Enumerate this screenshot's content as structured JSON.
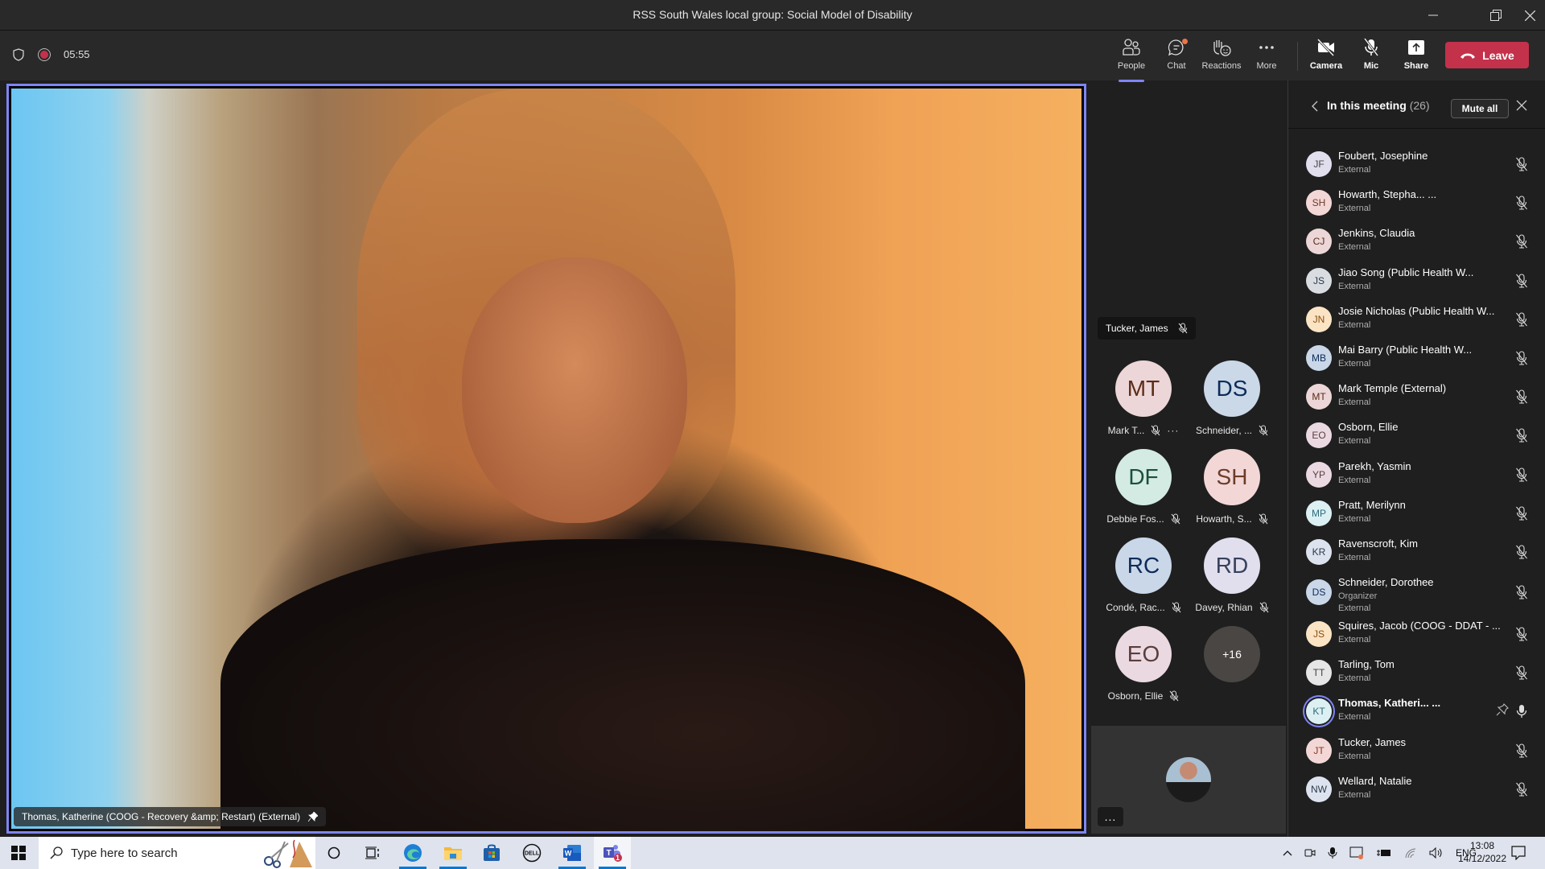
{
  "window": {
    "title": "RSS South Wales local group: Social Model of Disability",
    "controls": [
      "minimize-icon",
      "restore-icon",
      "close-icon"
    ]
  },
  "toolbar": {
    "recording": true,
    "timer": "05:55",
    "buttons": [
      {
        "label": "People",
        "icon": "people-icon",
        "active": true
      },
      {
        "label": "Chat",
        "icon": "chat-icon",
        "badge": true
      },
      {
        "label": "Reactions",
        "icon": "reactions-icon"
      },
      {
        "label": "More",
        "icon": "more-icon"
      },
      {
        "label": "Camera",
        "icon": "camera-off-icon"
      },
      {
        "label": "Mic",
        "icon": "mic-off-icon"
      },
      {
        "label": "Share",
        "icon": "share-icon"
      }
    ],
    "leave_label": "Leave",
    "colors": {
      "accent": "#7f85f5",
      "leave": "#c4314b",
      "badge": "#e97548"
    }
  },
  "stage": {
    "pinned_name": "Thomas, Katherine (COOG - Recovery &amp; Restart) (External)"
  },
  "gallery": {
    "speaking": "Tucker, James",
    "tiles": [
      {
        "initials": "MT",
        "caption": "Mark T...",
        "bg": "#ecd6d7",
        "fg": "#5b2c17",
        "more": true
      },
      {
        "initials": "DS",
        "caption": "Schneider, ...",
        "bg": "#cad8e8",
        "fg": "#0d2b59"
      },
      {
        "initials": "DF",
        "caption": "Debbie Fos...",
        "bg": "#d3ebe3",
        "fg": "#1c4f3b"
      },
      {
        "initials": "SH",
        "caption": "Howarth, S...",
        "bg": "#f3d7d7",
        "fg": "#6b3d28"
      },
      {
        "initials": "RC",
        "caption": "Condé, Rac...",
        "bg": "#c9d7e8",
        "fg": "#0d2b59"
      },
      {
        "initials": "RD",
        "caption": "Davey, Rhian",
        "bg": "#e1dfee",
        "fg": "#37405c"
      },
      {
        "initials": "EO",
        "caption": "Osborn, Ellie",
        "bg": "#ebd9e2",
        "fg": "#5a3e3c"
      },
      {
        "initials": "+16",
        "caption": "",
        "bg": "#4a4644",
        "fg": "#ffffff",
        "overflow": true
      }
    ],
    "self_more": "..."
  },
  "panel": {
    "title": "In this meeting",
    "count": "(26)",
    "mute_all": "Mute all",
    "participants": [
      {
        "initials": "JF",
        "name": "Foubert, Josephine",
        "role": "External",
        "bg": "#e1dfee",
        "fg": "#444"
      },
      {
        "initials": "SH",
        "name": "Howarth, Stepha... ...",
        "role": "External",
        "bg": "#f3d7d7",
        "fg": "#6b3d28"
      },
      {
        "initials": "CJ",
        "name": "Jenkins, Claudia",
        "role": "External",
        "bg": "#ecd6d7",
        "fg": "#5b2c17"
      },
      {
        "initials": "JS",
        "name": "Jiao Song (Public Health W...",
        "role": "External",
        "bg": "#d9dde2",
        "fg": "#2b3a4d"
      },
      {
        "initials": "JN",
        "name": "Josie Nicholas (Public Health W...",
        "role": "External",
        "bg": "#fbe4c4",
        "fg": "#8a4e0f"
      },
      {
        "initials": "MB",
        "name": "Mai Barry (Public Health W...",
        "role": "External",
        "bg": "#c9d7e8",
        "fg": "#0d2b59"
      },
      {
        "initials": "MT",
        "name": "Mark Temple (External)",
        "role": "External",
        "bg": "#ecd6d7",
        "fg": "#5b2c17"
      },
      {
        "initials": "EO",
        "name": "Osborn, Ellie",
        "role": "External",
        "bg": "#ebd9e2",
        "fg": "#5a3e3c"
      },
      {
        "initials": "YP",
        "name": "Parekh, Yasmin",
        "role": "External",
        "bg": "#ebd9e2",
        "fg": "#5a3e3c"
      },
      {
        "initials": "MP",
        "name": "Pratt, Merilynn",
        "role": "External",
        "bg": "#dcf0f3",
        "fg": "#2f6a7a"
      },
      {
        "initials": "KR",
        "name": "Ravenscroft, Kim",
        "role": "External",
        "bg": "#dde3ee",
        "fg": "#2b3a4d"
      },
      {
        "initials": "DS",
        "name": "Schneider, Dorothee",
        "role": "Organizer",
        "role2": "External",
        "bg": "#c9d7e8",
        "fg": "#0d2b59"
      },
      {
        "initials": "JS",
        "name": "Squires, Jacob (COOG - DDAT - ...",
        "role": "External",
        "bg": "#fbe4c4",
        "fg": "#8a4e0f"
      },
      {
        "initials": "TT",
        "name": "Tarling, Tom",
        "role": "External",
        "bg": "#e6e6e6",
        "fg": "#444"
      },
      {
        "initials": "KT",
        "name": "Thomas, Katheri... ...",
        "role": "External",
        "bg": "#dcf0f3",
        "fg": "#2f6a7a",
        "speaking": true,
        "pinned": true
      },
      {
        "initials": "JT",
        "name": "Tucker, James",
        "role": "External",
        "bg": "#f3d7d7",
        "fg": "#8a3a12"
      },
      {
        "initials": "NW",
        "name": "Wellard, Natalie",
        "role": "External",
        "bg": "#dde3ee",
        "fg": "#2b3a4d"
      }
    ]
  },
  "taskbar": {
    "search_placeholder": "Type here to search",
    "apps": [
      "cortana-icon",
      "task-view-icon",
      "edge-icon",
      "file-explorer-icon",
      "store-icon",
      "dell-icon",
      "word-icon",
      "teams-icon"
    ],
    "teams_badge": "1",
    "tray_language": "ENG",
    "time": "13:08",
    "date": "14/12/2022"
  }
}
